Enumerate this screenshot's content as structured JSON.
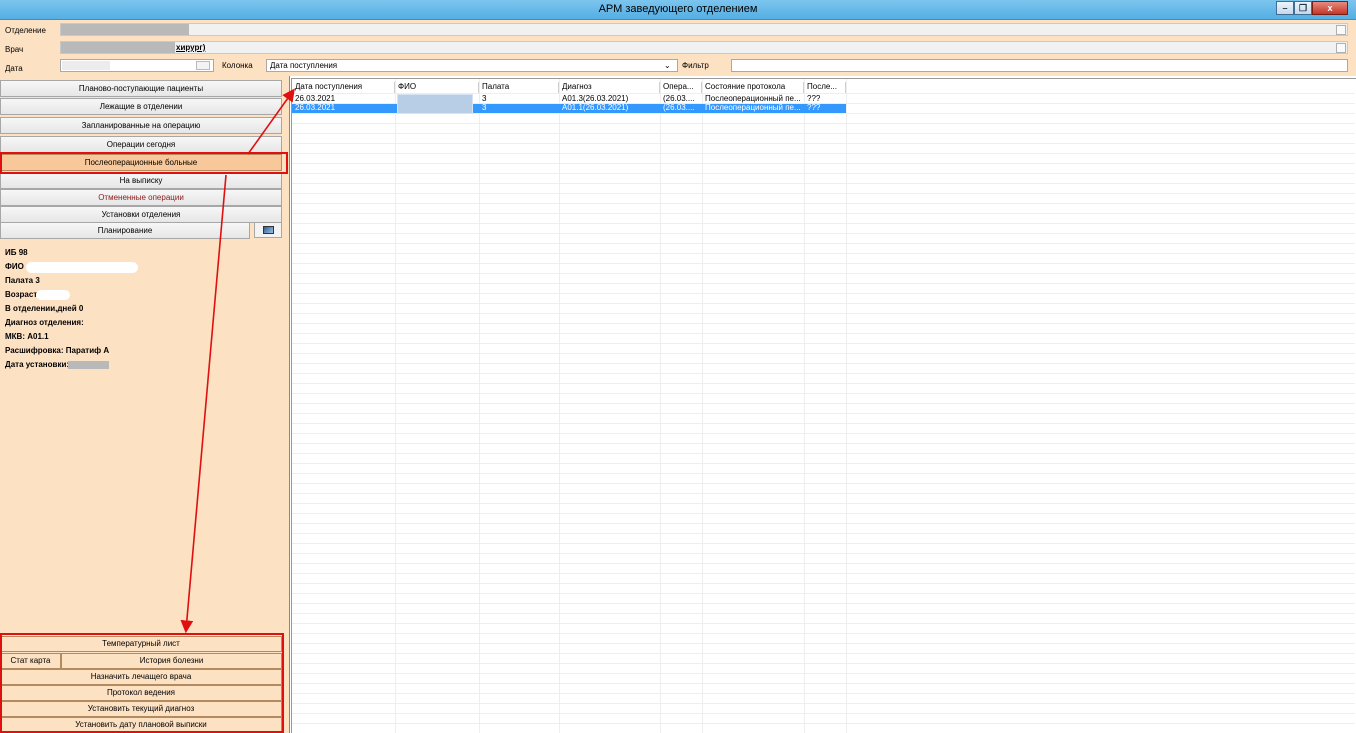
{
  "window": {
    "title": "АРМ заведующего отделением",
    "buttons": [
      "–",
      "❐",
      "x"
    ]
  },
  "form": {
    "department_label": "Отделение",
    "doctor_label": "Врач",
    "doctor_value_suffix": "хирург)",
    "date_label": "Дата",
    "column_label": "Колонка",
    "column_value": "Дата поступления",
    "filter_label": "Фильтр",
    "filter_value": ""
  },
  "nav": {
    "items": [
      {
        "label": "Планово-поступающие пациенты"
      },
      {
        "label": "Лежащие в отделении"
      },
      {
        "label": "Запланированные на операцию"
      },
      {
        "label": "Операции сегодня"
      },
      {
        "label": "Послеоперационные больные",
        "active": true
      },
      {
        "label": "На выписку"
      },
      {
        "label": "Отмененные операции"
      },
      {
        "label": "Установки отделения"
      },
      {
        "label": "Планирование"
      }
    ]
  },
  "patient_info": {
    "ib": "ИБ 98",
    "fio": "ФИО",
    "ward": "Палата 3",
    "age": "Возраст",
    "days": "В отделении,дней 0",
    "dept_diagnosis": "Диагноз отделения:",
    "mkb": "МКВ: А01.1",
    "decoding": "Расшифровка: Паратиф А",
    "install_date": "Дата установки:"
  },
  "actions": {
    "temp_sheet": "Температурный лист",
    "stat_card": "Стат карта",
    "history": "История болезни",
    "assign_doctor": "Назначить лечащего врача",
    "protocol": "Протокол ведения",
    "set_diagnosis": "Установить текущий диагноз",
    "set_discharge_date": "Установить дату плановой выписки"
  },
  "table": {
    "headers": [
      "Дата поступления",
      "ФИО",
      "Палата",
      "Диагноз",
      "Опера...",
      "Состояние протокола",
      "После..."
    ],
    "rows": [
      [
        "26.03.2021",
        "",
        "3",
        "А01.3(26.03.2021)",
        "(26.03....",
        "Послеоперационный пе...",
        "???"
      ],
      [
        "26.03.2021",
        "",
        "3",
        "А01.1(26.03.2021)",
        "(26.03....",
        "Послеоперационный пе...",
        "???"
      ]
    ],
    "selected_row": 1
  },
  "colors": {
    "panel": "#fde1c3",
    "active": "#f8c89a",
    "selection": "#3399ff",
    "annotation": "#e01010",
    "titlebar": "#6bbbe9"
  }
}
